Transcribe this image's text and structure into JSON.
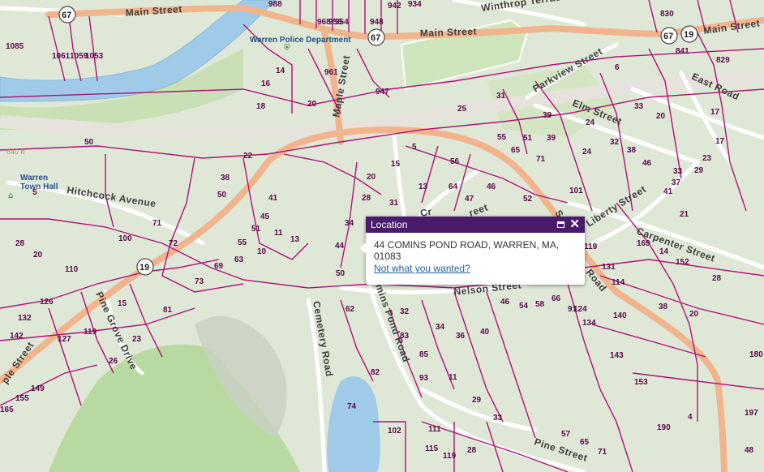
{
  "colors": {
    "parcel_line": "#b0127a",
    "land": "#dfe8d6",
    "water": "#9fcbe8",
    "major_road": "#f2b48c",
    "minor_road": "#ffffff",
    "forest": "#b8d9a0",
    "popup_header": "#4a1a6b"
  },
  "roads": {
    "main_street_w": "Main Street",
    "main_street_c": "Main Street",
    "main_street_e": "Main Street",
    "winthrop": "Winthrop Terrace",
    "maple_n": "Maple Street",
    "maple_s": "ple Street",
    "hitchcock": "Hitchcock Avenue",
    "east_road": "East Road",
    "parkview": "Parkview Street",
    "elm": "Elm Street",
    "liberty": "Liberty Street",
    "carpenter": "Carpenter Street",
    "nelson": "Nelson Street",
    "comins_pond": "mins Pond Road",
    "cemetery": "Cemetery Road",
    "pine_grove": "Pine Grove Drive",
    "pine": "Pine Street",
    "road_fragment": "Road",
    "cr_fragment": "Cr",
    "reet_fragment": "reet",
    "s_fragment": "S"
  },
  "shields": [
    "67",
    "67",
    "67",
    "19",
    "19"
  ],
  "places": {
    "police": "Warren Police Department",
    "town_hall_line1": "Warren",
    "town_hall_line2": "Town Hall",
    "elevation": "640 ft"
  },
  "parcels": [
    "988",
    "968",
    "956",
    "954",
    "948",
    "942",
    "934",
    "830",
    "1085",
    "1061",
    "1059",
    "1053",
    "14",
    "16",
    "18",
    "961",
    "947",
    "20",
    "6",
    "841",
    "829",
    "25",
    "31",
    "39",
    "39",
    "55",
    "51",
    "65",
    "71",
    "24",
    "24",
    "32",
    "38",
    "46",
    "33",
    "20",
    "17",
    "17",
    "23",
    "29",
    "33",
    "37",
    "41",
    "21",
    "50",
    "22",
    "38",
    "50",
    "20",
    "15",
    "5",
    "56",
    "13",
    "64",
    "47",
    "46",
    "52",
    "45",
    "41",
    "51",
    "11",
    "13",
    "28",
    "31",
    "34",
    "44",
    "50",
    "55",
    "10",
    "63",
    "69",
    "73",
    "81",
    "100",
    "72",
    "71",
    "28",
    "20",
    "110",
    "126",
    "132",
    "142",
    "127",
    "119",
    "15",
    "23",
    "26",
    "149",
    "155",
    "165",
    "62",
    "32",
    "34",
    "83",
    "36",
    "40",
    "85",
    "93",
    "11",
    "82",
    "74",
    "29",
    "33",
    "111",
    "115",
    "119",
    "28",
    "102",
    "57",
    "65",
    "71",
    "46",
    "54",
    "58",
    "66",
    "91",
    "101",
    "119",
    "131",
    "114",
    "124",
    "134",
    "140",
    "143",
    "153",
    "38",
    "20",
    "28",
    "14",
    "152",
    "169",
    "180",
    "190",
    "4",
    "197",
    "48",
    "5"
  ],
  "popup": {
    "title": "Location",
    "address": "44 COMINS POND ROAD, WARREN, MA, 01083",
    "link": "Not what you wanted?"
  }
}
